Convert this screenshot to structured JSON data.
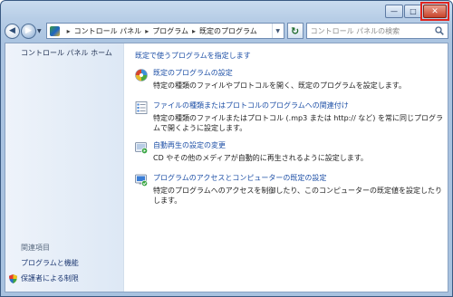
{
  "window": {
    "caption": {
      "minimize": "—",
      "maximize": "□",
      "close": "✕"
    }
  },
  "nav": {
    "back_glyph": "◀",
    "forward_glyph": "▶",
    "history_dropdown_glyph": "▼",
    "breadcrumbs": [
      "コントロール パネル",
      "プログラム",
      "既定のプログラム"
    ],
    "breadcrumb_separator": "▸",
    "address_dropdown_glyph": "▼",
    "refresh_glyph": "↻",
    "search_placeholder": "コントロール パネルの検索"
  },
  "sidebar": {
    "home": "コントロール パネル ホーム",
    "related_heading": "関連項目",
    "links": [
      {
        "label": "プログラムと機能"
      },
      {
        "label": "保護者による制限"
      }
    ]
  },
  "main": {
    "header": "既定で使うプログラムを指定します",
    "tasks": [
      {
        "title": "既定のプログラムの設定",
        "description": "特定の種類のファイルやプロトコルを開く、既定のプログラムを設定します。",
        "icon": "default-programs-icon"
      },
      {
        "title": "ファイルの種類またはプロトコルのプログラムへの関連付け",
        "description": "特定の種類のファイルまたはプロトコル (.mp3 または http:// など) を常に同じプログラムで開くように設定します。",
        "icon": "file-association-icon"
      },
      {
        "title": "自動再生の設定の変更",
        "description": "CD やその他のメディアが自動的に再生されるように設定します。",
        "icon": "autoplay-icon"
      },
      {
        "title": "プログラムのアクセスとコンピューターの既定の設定",
        "description": "特定のプログラムへのアクセスを制御したり、このコンピューターの既定値を設定したりします。",
        "icon": "program-access-icon"
      }
    ]
  },
  "colors": {
    "link": "#1d4fa6",
    "close_highlight": "#e1241f",
    "frame": "#a8c2df"
  }
}
